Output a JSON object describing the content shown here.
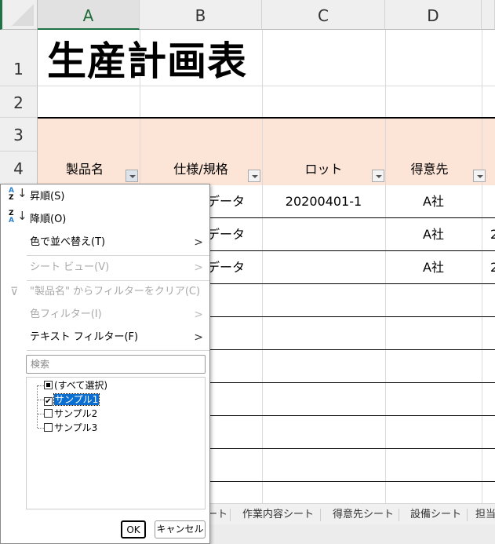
{
  "columns": [
    "A",
    "B",
    "C",
    "D"
  ],
  "rows": [
    "1",
    "2",
    "3",
    "4"
  ],
  "sheet": {
    "title": "生産計画表",
    "headers": [
      "製品名",
      "仕様/規格",
      "ロット",
      "得意先"
    ],
    "data_rows": [
      {
        "spec": "データ",
        "lot": "20200401-1",
        "customer": "A社",
        "next": ""
      },
      {
        "spec": "データ",
        "lot": "",
        "customer": "A社",
        "next": "2"
      },
      {
        "spec": "データ",
        "lot": "",
        "customer": "A社",
        "next": "2"
      }
    ],
    "header_fill": "#fce4d6"
  },
  "filter_menu": {
    "sort_asc": "昇順(S)",
    "sort_desc": "降順(O)",
    "sort_by_color": "色で並べ替え(T)",
    "sheet_view": "シート ビュー(V)",
    "clear_filter": "\"製品名\" からフィルターをクリア(C)",
    "color_filter": "色フィルター(I)",
    "text_filter": "テキスト フィルター(F)",
    "search_placeholder": "検索",
    "items": [
      {
        "label": "(すべて選択)",
        "state": "partial"
      },
      {
        "label": "サンプル1",
        "state": "checked"
      },
      {
        "label": "サンプル2",
        "state": "unchecked"
      },
      {
        "label": "サンプル3",
        "state": "unchecked"
      }
    ],
    "ok": "OK",
    "cancel": "キャンセル"
  },
  "sheet_tabs": [
    "ート",
    "作業内容シート",
    "得意先シート",
    "設備シート",
    "担当"
  ]
}
